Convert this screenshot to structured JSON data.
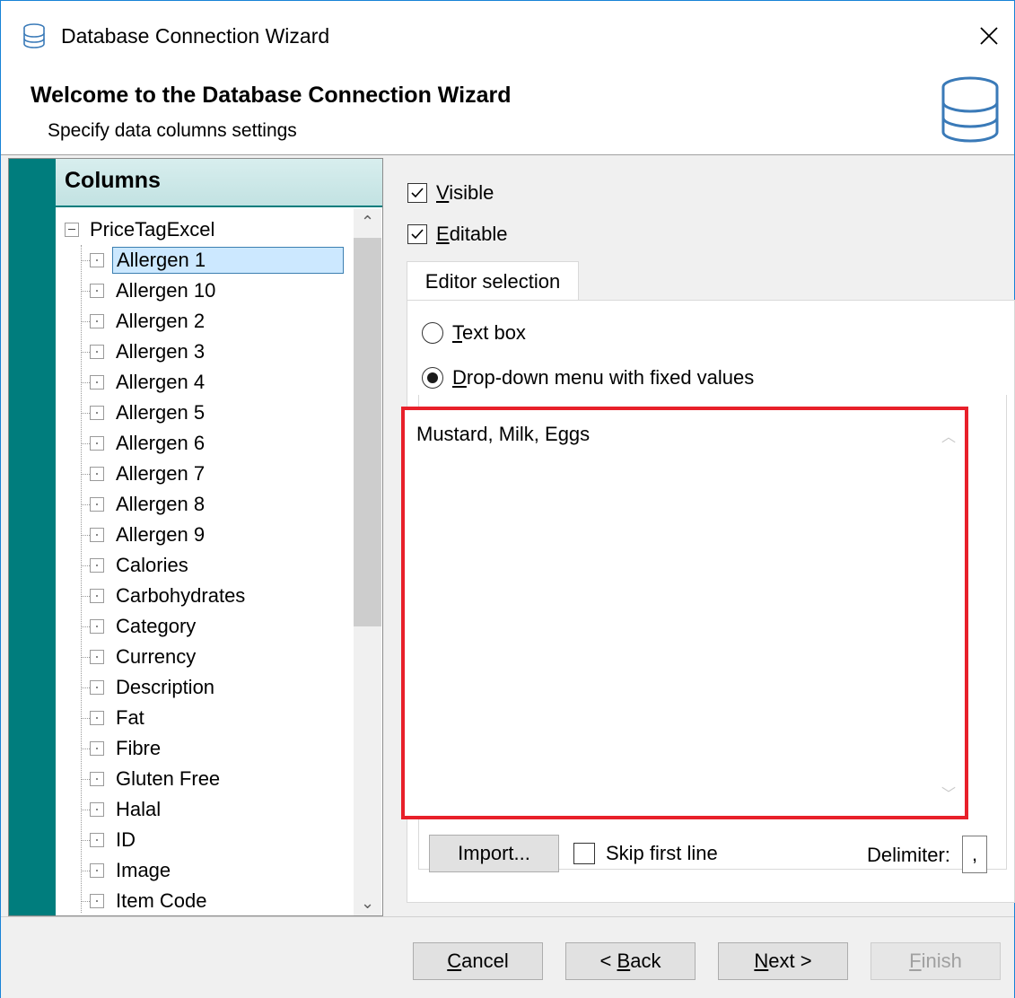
{
  "window": {
    "title": "Database Connection Wizard",
    "close_icon": "close-icon",
    "app_icon": "database-icon"
  },
  "header": {
    "title": "Welcome to the Database Connection Wizard",
    "subtitle": "Specify data columns settings",
    "icon": "database-icon"
  },
  "columns_panel": {
    "title": "Columns",
    "root": "PriceTagExcel",
    "selected": "Allergen 1",
    "items": [
      {
        "label": "Allergen 1"
      },
      {
        "label": "Allergen 10"
      },
      {
        "label": "Allergen 2"
      },
      {
        "label": "Allergen 3"
      },
      {
        "label": "Allergen 4"
      },
      {
        "label": "Allergen 5"
      },
      {
        "label": "Allergen 6"
      },
      {
        "label": "Allergen 7"
      },
      {
        "label": "Allergen 8"
      },
      {
        "label": "Allergen 9"
      },
      {
        "label": "Calories"
      },
      {
        "label": "Carbohydrates"
      },
      {
        "label": "Category"
      },
      {
        "label": "Currency"
      },
      {
        "label": "Description"
      },
      {
        "label": "Fat"
      },
      {
        "label": "Fibre"
      },
      {
        "label": "Gluten Free"
      },
      {
        "label": "Halal"
      },
      {
        "label": "ID"
      },
      {
        "label": "Image"
      },
      {
        "label": "Item Code"
      }
    ]
  },
  "settings": {
    "visible": {
      "accel": "V",
      "rest": "isible",
      "checked": true
    },
    "editable": {
      "accel": "E",
      "rest": "ditable",
      "checked": true
    },
    "tab_label": "Editor selection",
    "text_box": {
      "accel": "T",
      "rest": "ext box",
      "checked": false
    },
    "dropdown": {
      "accel": "D",
      "rest": "rop-down menu with fixed values",
      "checked": true
    },
    "fixed_values": "Mustard, Milk, Eggs",
    "import_label": "Import...",
    "skip_first_line_label": "Skip first line",
    "skip_first_line_checked": false,
    "delimiter_label": "Delimiter:",
    "delimiter_value": ","
  },
  "footer": {
    "cancel": {
      "accel": "C",
      "rest": "ancel"
    },
    "back": {
      "pre": "< ",
      "accel": "B",
      "rest": "ack"
    },
    "next": {
      "accel": "N",
      "rest": "ext >"
    },
    "finish": {
      "accel": "F",
      "rest": "inish",
      "disabled": true
    }
  },
  "colors": {
    "accent_teal": "#007d7d",
    "selection": "#cce8ff",
    "highlight_border": "#e8202a",
    "icon_blue": "#3a7ab8"
  }
}
